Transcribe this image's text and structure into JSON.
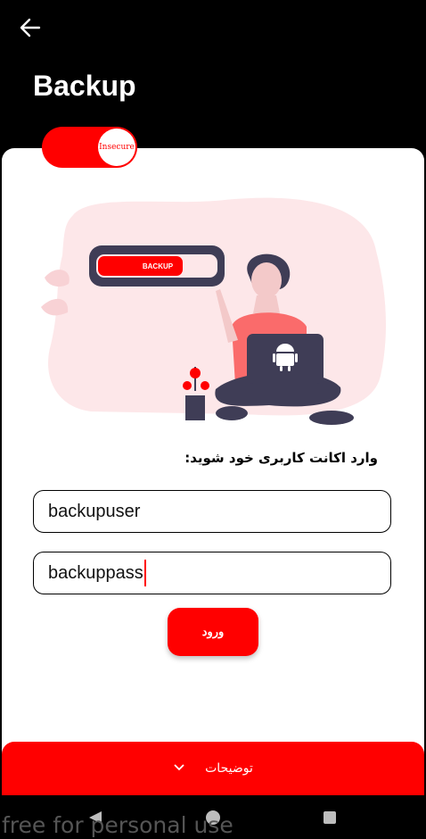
{
  "header": {
    "title": "Backup"
  },
  "toggle": {
    "label": "Insecure"
  },
  "illustration": {
    "badge_label": "BACKUP"
  },
  "form": {
    "prompt": "وارد اکانت کاربری خود شوید:",
    "username_value": "backupuser",
    "password_value": "backuppass",
    "login_label": "ورود"
  },
  "footer": {
    "description_label": "توضیحات"
  },
  "watermark": "free for personal use",
  "colors": {
    "accent": "#ff0000",
    "background": "#000000",
    "card": "#ffffff"
  }
}
